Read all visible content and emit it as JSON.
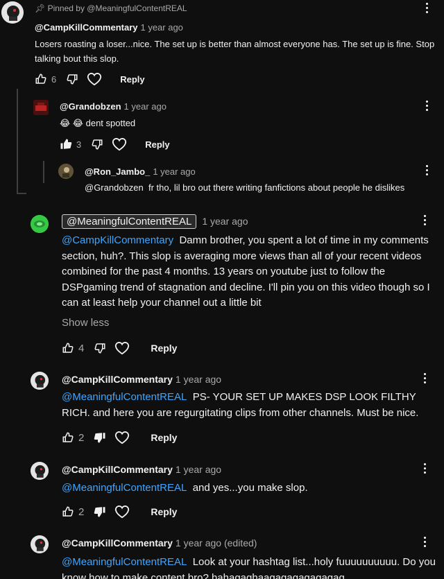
{
  "pinned_label": "Pinned by @MeaningfulContentREAL",
  "comments": [
    {
      "author": "@CampKillCommentary",
      "date": "1 year ago",
      "text": "Losers roasting a loser...nice. The set up is better than almost everyone has. The set up is fine. Stop talking bout this slop.",
      "likes": "6",
      "reply_label": "Reply"
    },
    {
      "author": "@Grandobzen",
      "date": "1 year ago",
      "text": "😂 😂 dent spotted",
      "likes": "3",
      "reply_label": "Reply"
    },
    {
      "author": "@Ron_Jambo_",
      "date": "1 year ago",
      "mention": "@Grandobzen",
      "text": "fr tho, lil bro out there writing fanfictions about people he dislikes"
    },
    {
      "author": "@MeaningfulContentREAL",
      "date": "1 year ago",
      "mention": "@CampKillCommentary",
      "text": "Damn brother, you spent a lot of time in my comments section, huh?. This slop is averaging more views than all of your recent videos combined for the past 4 months. 13 years on youtube just to follow the DSPgaming trend of stagnation and decline. I'll pin you on this video though so I can at least help your channel out a little bit",
      "show_less": "Show less",
      "likes": "4",
      "reply_label": "Reply"
    },
    {
      "author": "@CampKillCommentary",
      "date": "1 year ago",
      "mention": "@MeaningfulContentREAL",
      "text": "PS- YOUR SET UP MAKES DSP LOOK FILTHY RICH. and here you are regurgitating clips from other channels. Must be nice.",
      "likes": "2",
      "reply_label": "Reply"
    },
    {
      "author": "@CampKillCommentary",
      "date": "1 year ago",
      "mention": "@MeaningfulContentREAL",
      "text": "and yes...you make slop.",
      "likes": "2",
      "reply_label": "Reply"
    },
    {
      "author": "@CampKillCommentary",
      "date": "1 year ago",
      "edited": "(edited)",
      "mention": "@MeaningfulContentREAL",
      "text": "Look at your hashtag list...holy fuuuuuuuuuu. Do you know how to make content bro? hahagaghaagagagagagagag"
    }
  ],
  "colors": {
    "background": "#0f0f0f",
    "text": "#f1f1f1",
    "secondary": "#aaaaaa",
    "mention": "#3ea6ff"
  }
}
